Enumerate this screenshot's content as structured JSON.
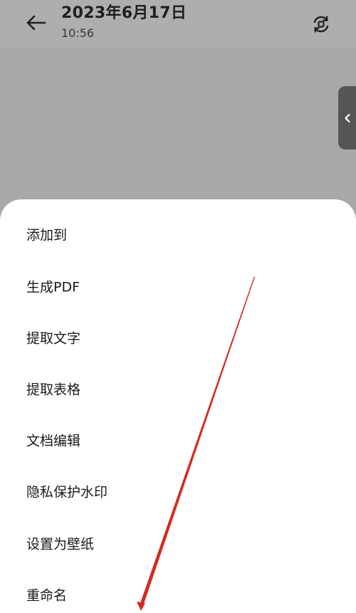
{
  "header": {
    "title": "2023年6月17日",
    "subtitle": "10:56",
    "back_icon": "arrow-left-icon",
    "rotate_icon": "rotate-icon"
  },
  "side_tab": {
    "icon": "chevron-left-icon"
  },
  "menu": {
    "items": [
      {
        "label": "添加到"
      },
      {
        "label": "生成PDF"
      },
      {
        "label": "提取文字"
      },
      {
        "label": "提取表格"
      },
      {
        "label": "文档编辑"
      },
      {
        "label": "隐私保护水印"
      },
      {
        "label": "设置为壁纸"
      },
      {
        "label": "重命名"
      }
    ]
  },
  "colors": {
    "overlay": "#a8a8a8",
    "sheet": "#ffffff",
    "annotation_arrow": "#d42a1f"
  }
}
